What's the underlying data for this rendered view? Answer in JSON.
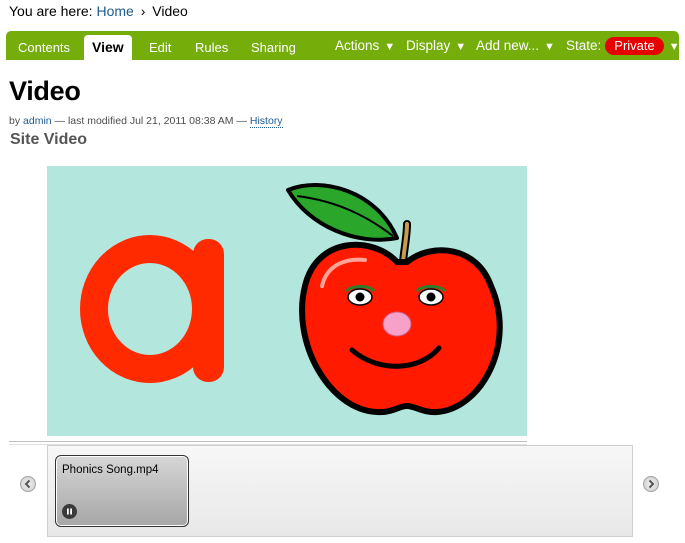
{
  "breadcrumb": {
    "prefix": "You are here:",
    "home": "Home",
    "separator": "›",
    "current": "Video"
  },
  "editbar": {
    "tabs": [
      {
        "label": "Contents"
      },
      {
        "label": "View",
        "active": true
      },
      {
        "label": "Edit"
      },
      {
        "label": "Rules"
      },
      {
        "label": "Sharing"
      }
    ],
    "actions_label": "Actions",
    "display_label": "Display",
    "add_new_label": "Add new...",
    "state_label": "State:",
    "state_value": "Private",
    "arrow_glyph": "▼"
  },
  "page": {
    "title": "Video",
    "by": "by",
    "author": "admin",
    "modified_text": "— last modified Jul 21, 2011 08:38 AM —",
    "history": "History",
    "description": "Site Video"
  },
  "player": {
    "thumbnail_title": "Phonics Song.mp4"
  },
  "icons": {
    "prev": "chevron-left-icon",
    "next": "chevron-right-icon",
    "pause": "pause-icon"
  },
  "colors": {
    "editbar": "#75ad0a",
    "state_badge": "#e60000",
    "link": "#205c90",
    "video_bg": "#b3e7de",
    "apple_red": "#ff1a00",
    "letter_red": "#ff2a00"
  }
}
